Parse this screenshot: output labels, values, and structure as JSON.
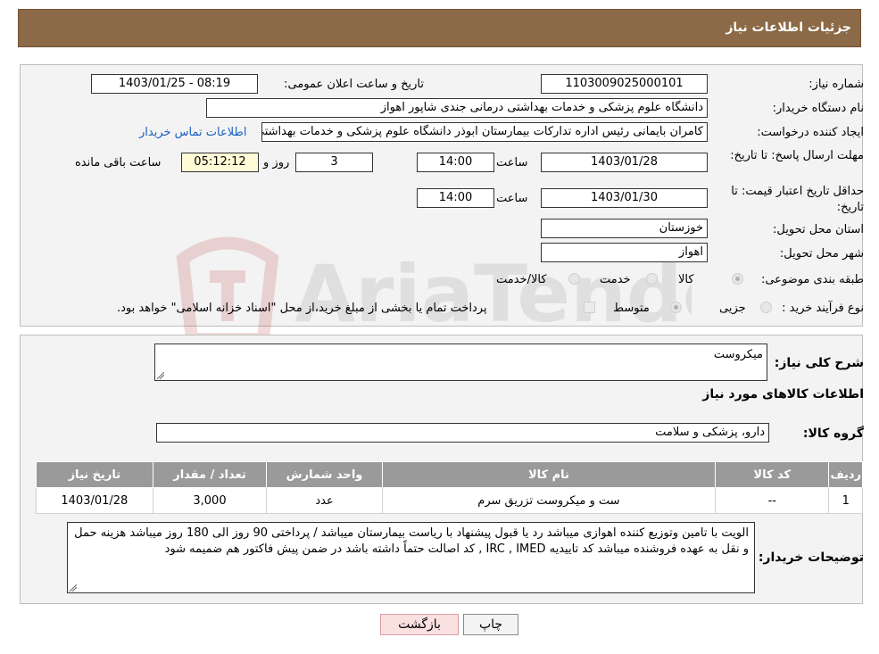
{
  "header": {
    "title": "جزئیات اطلاعات نیاز"
  },
  "form": {
    "need_number_label": "شماره نیاز:",
    "need_number": "1103009025000101",
    "announce_label": "تاریخ و ساعت اعلان عمومی:",
    "announce_value": "1403/01/25 - 08:19",
    "buyer_org_label": "نام دستگاه خریدار:",
    "buyer_org": "دانشگاه علوم پزشکی و خدمات بهداشتی درمانی جندی شاپور اهواز",
    "requester_label": "ایجاد کننده درخواست:",
    "requester": "کامران بایمانی رئیس اداره تدارکات بیمارستان ابوذر  دانشگاه علوم پزشکی و خدمات بهداشتی درمانی جندی شاپور اهواز",
    "contact_link": "اطلاعات تماس خریدار",
    "deadline_label": "مهلت ارسال پاسخ: تا تاریخ:",
    "deadline_date": "1403/01/28",
    "time_label": "ساعت",
    "deadline_time": "14:00",
    "days_value": "3",
    "days_label": "روز و",
    "remaining_time": "05:12:12",
    "remaining_label": "ساعت باقی مانده",
    "validity_label": "حداقل تاریخ اعتبار قیمت: تا تاریخ:",
    "validity_date": "1403/01/30",
    "validity_time": "14:00",
    "province_label": "استان محل تحویل:",
    "province": "خوزستان",
    "city_label": "شهر محل تحویل:",
    "city": "اهواز",
    "category_label": "طبقه بندی موضوعی:",
    "category_options": [
      "کالا",
      "خدمت",
      "کالا/خدمت"
    ],
    "purchase_type_label": "نوع فرآیند خرید :",
    "purchase_options": [
      "جزیی",
      "متوسط"
    ],
    "purchase_note": "پرداخت تمام یا بخشی از مبلغ خرید،از محل \"اسناد خزانه اسلامی\" خواهد بود."
  },
  "summary": {
    "description_label": "شرح کلی نیاز:",
    "description": "میکروست",
    "goods_info_title": "اطلاعات کالاهای مورد نیاز",
    "group_label": "گروه کالا:",
    "group_value": "دارو، پزشکی و سلامت",
    "table": {
      "headers": [
        "ردیف",
        "کد کالا",
        "نام کالا",
        "واحد شمارش",
        "تعداد / مقدار",
        "تاریخ نیاز"
      ],
      "rows": [
        [
          "1",
          "--",
          "ست و میکروست تزریق سرم",
          "عدد",
          "3,000",
          "1403/01/28"
        ]
      ]
    },
    "buyer_notes_label": "توضیحات خریدار:",
    "buyer_notes": "الویت با تامین وتوزیع کننده اهوازی  میباشد رد یا قبول پیشنهاد با ریاست بیمارستان میباشد / پرداختی 90 روز  الی 180 روز میباشد  هزینه حمل و نقل به عهده فروشنده میباشد   کد تاییدیه IRC , IMED , کد اصالت حتماً داشته باشد در ضمن پیش فاکتور هم ضمیمه شود"
  },
  "buttons": {
    "print": "چاپ",
    "back": "بازگشت"
  },
  "watermark": {
    "text": "AriaTender.neT"
  }
}
